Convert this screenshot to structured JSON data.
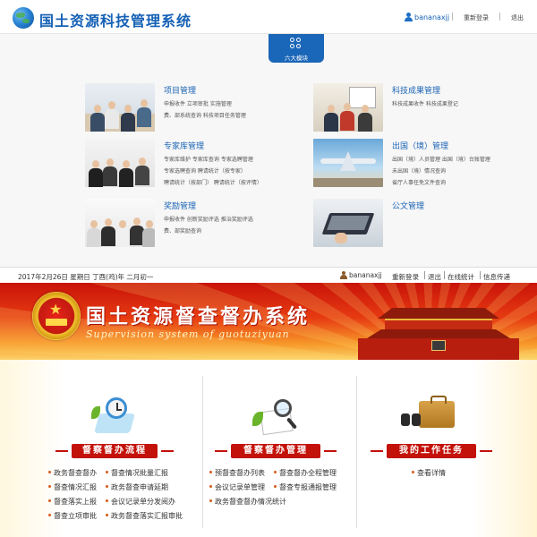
{
  "top_system": {
    "title": "国土资源科技管理系统",
    "username": "bananaxjj",
    "relogin": "重新登录",
    "logout": "退出",
    "badge": "六大模块",
    "modules": [
      {
        "title": "项目管理",
        "lines": [
          "申报收件    立项审批    实施管理",
          "费、部系统查询    科技项目任务管理"
        ]
      },
      {
        "title": "科技成果管理",
        "lines": [
          "科技成果收件    科技成果登记"
        ]
      },
      {
        "title": "专家库管理",
        "lines": [
          "专家库维护    专家库查询    专家选聘管理",
          "专家选聘查询    聘请统计（按专家）",
          "聘请统计（按部门）    聘请统计（按评情）"
        ]
      },
      {
        "title": "出国（境）管理",
        "lines": [
          "出国（境）人员管理    出国（境）台账管理",
          "未出国（境）情况查询",
          "省厅人事任免文件查询"
        ]
      },
      {
        "title": "奖励管理",
        "lines": [
          "申报收件    创新奖励评选    推治奖励评选",
          "费、部奖励查询"
        ]
      },
      {
        "title": "公文管理",
        "lines": []
      }
    ]
  },
  "supervision_system": {
    "date_line": "2017年2月26日 星期日 丁酉(鸡)年 二月初一",
    "username": "bananaxjj",
    "links": [
      "重新登录",
      "退出",
      "在线统计",
      "信息传递"
    ],
    "banner_title": "国土资源督查督办系统",
    "banner_subtitle": "Supervision system of guotuziyuan",
    "panels": [
      {
        "heading": "督察督办流程",
        "items": [
          "政务督查督办",
          "督查情况批量汇报",
          "督查情况汇报",
          "政务督查申请延期",
          "督查落实上报",
          "会议记录单分发阅办",
          "督查立项审批",
          "政务督查落实汇报审批"
        ]
      },
      {
        "heading": "督察督办管理",
        "items": [
          "预督查督办列表",
          "督查督办全程管理",
          "会议记录单管理",
          "督查专报通报管理",
          "政务督查督办情况统计"
        ]
      },
      {
        "heading": "我的工作任务",
        "items": [
          "查看详情"
        ]
      }
    ]
  },
  "colors": {
    "brand_blue": "#1561b5",
    "banner_red": "#c91409",
    "pill_red": "#c3120a"
  },
  "icons": [
    "globe-logo-icon",
    "user-icon",
    "grid-icon",
    "national-emblem-icon",
    "clipboard-clock-icon",
    "magnifier-icon",
    "briefcase-icon"
  ]
}
